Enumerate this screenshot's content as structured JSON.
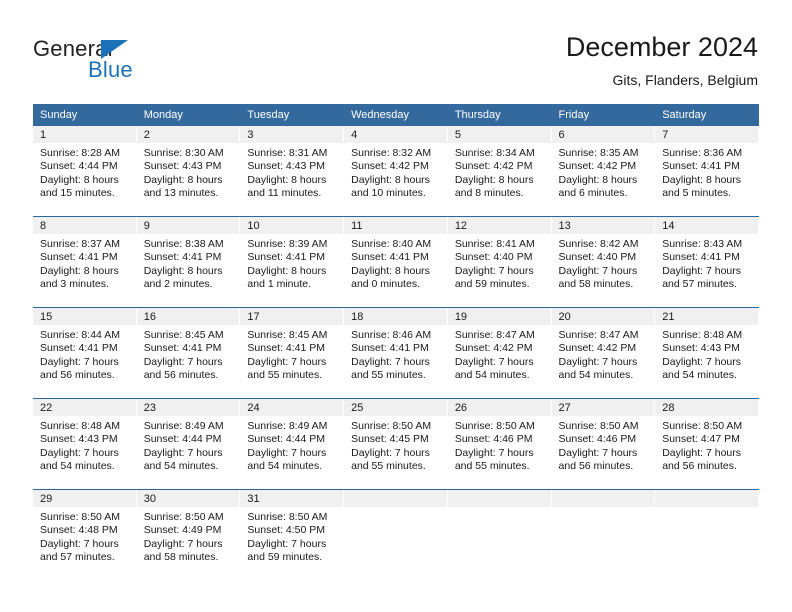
{
  "brand": {
    "logo_line1": "General",
    "logo_line2": "Blue",
    "logo_color_dark": "#231f20",
    "logo_color_blue": "#1c72b8",
    "triangle_icon": "triangle-icon"
  },
  "header": {
    "title": "December 2024",
    "subtitle": "Gits, Flanders, Belgium"
  },
  "theme": {
    "header_bg": "#34699e",
    "header_text": "#ffffff",
    "daynum_bg": "#f0f0f0",
    "row_divider": "#2a679f",
    "body_text": "#1a1a1a"
  },
  "calendar": {
    "weekdays": [
      "Sunday",
      "Monday",
      "Tuesday",
      "Wednesday",
      "Thursday",
      "Friday",
      "Saturday"
    ],
    "weeks": [
      [
        {
          "day": "1",
          "sunrise": "Sunrise: 8:28 AM",
          "sunset": "Sunset: 4:44 PM",
          "daylight_1": "Daylight: 8 hours",
          "daylight_2": "and 15 minutes."
        },
        {
          "day": "2",
          "sunrise": "Sunrise: 8:30 AM",
          "sunset": "Sunset: 4:43 PM",
          "daylight_1": "Daylight: 8 hours",
          "daylight_2": "and 13 minutes."
        },
        {
          "day": "3",
          "sunrise": "Sunrise: 8:31 AM",
          "sunset": "Sunset: 4:43 PM",
          "daylight_1": "Daylight: 8 hours",
          "daylight_2": "and 11 minutes."
        },
        {
          "day": "4",
          "sunrise": "Sunrise: 8:32 AM",
          "sunset": "Sunset: 4:42 PM",
          "daylight_1": "Daylight: 8 hours",
          "daylight_2": "and 10 minutes."
        },
        {
          "day": "5",
          "sunrise": "Sunrise: 8:34 AM",
          "sunset": "Sunset: 4:42 PM",
          "daylight_1": "Daylight: 8 hours",
          "daylight_2": "and 8 minutes."
        },
        {
          "day": "6",
          "sunrise": "Sunrise: 8:35 AM",
          "sunset": "Sunset: 4:42 PM",
          "daylight_1": "Daylight: 8 hours",
          "daylight_2": "and 6 minutes."
        },
        {
          "day": "7",
          "sunrise": "Sunrise: 8:36 AM",
          "sunset": "Sunset: 4:41 PM",
          "daylight_1": "Daylight: 8 hours",
          "daylight_2": "and 5 minutes."
        }
      ],
      [
        {
          "day": "8",
          "sunrise": "Sunrise: 8:37 AM",
          "sunset": "Sunset: 4:41 PM",
          "daylight_1": "Daylight: 8 hours",
          "daylight_2": "and 3 minutes."
        },
        {
          "day": "9",
          "sunrise": "Sunrise: 8:38 AM",
          "sunset": "Sunset: 4:41 PM",
          "daylight_1": "Daylight: 8 hours",
          "daylight_2": "and 2 minutes."
        },
        {
          "day": "10",
          "sunrise": "Sunrise: 8:39 AM",
          "sunset": "Sunset: 4:41 PM",
          "daylight_1": "Daylight: 8 hours",
          "daylight_2": "and 1 minute."
        },
        {
          "day": "11",
          "sunrise": "Sunrise: 8:40 AM",
          "sunset": "Sunset: 4:41 PM",
          "daylight_1": "Daylight: 8 hours",
          "daylight_2": "and 0 minutes."
        },
        {
          "day": "12",
          "sunrise": "Sunrise: 8:41 AM",
          "sunset": "Sunset: 4:40 PM",
          "daylight_1": "Daylight: 7 hours",
          "daylight_2": "and 59 minutes."
        },
        {
          "day": "13",
          "sunrise": "Sunrise: 8:42 AM",
          "sunset": "Sunset: 4:40 PM",
          "daylight_1": "Daylight: 7 hours",
          "daylight_2": "and 58 minutes."
        },
        {
          "day": "14",
          "sunrise": "Sunrise: 8:43 AM",
          "sunset": "Sunset: 4:41 PM",
          "daylight_1": "Daylight: 7 hours",
          "daylight_2": "and 57 minutes."
        }
      ],
      [
        {
          "day": "15",
          "sunrise": "Sunrise: 8:44 AM",
          "sunset": "Sunset: 4:41 PM",
          "daylight_1": "Daylight: 7 hours",
          "daylight_2": "and 56 minutes."
        },
        {
          "day": "16",
          "sunrise": "Sunrise: 8:45 AM",
          "sunset": "Sunset: 4:41 PM",
          "daylight_1": "Daylight: 7 hours",
          "daylight_2": "and 56 minutes."
        },
        {
          "day": "17",
          "sunrise": "Sunrise: 8:45 AM",
          "sunset": "Sunset: 4:41 PM",
          "daylight_1": "Daylight: 7 hours",
          "daylight_2": "and 55 minutes."
        },
        {
          "day": "18",
          "sunrise": "Sunrise: 8:46 AM",
          "sunset": "Sunset: 4:41 PM",
          "daylight_1": "Daylight: 7 hours",
          "daylight_2": "and 55 minutes."
        },
        {
          "day": "19",
          "sunrise": "Sunrise: 8:47 AM",
          "sunset": "Sunset: 4:42 PM",
          "daylight_1": "Daylight: 7 hours",
          "daylight_2": "and 54 minutes."
        },
        {
          "day": "20",
          "sunrise": "Sunrise: 8:47 AM",
          "sunset": "Sunset: 4:42 PM",
          "daylight_1": "Daylight: 7 hours",
          "daylight_2": "and 54 minutes."
        },
        {
          "day": "21",
          "sunrise": "Sunrise: 8:48 AM",
          "sunset": "Sunset: 4:43 PM",
          "daylight_1": "Daylight: 7 hours",
          "daylight_2": "and 54 minutes."
        }
      ],
      [
        {
          "day": "22",
          "sunrise": "Sunrise: 8:48 AM",
          "sunset": "Sunset: 4:43 PM",
          "daylight_1": "Daylight: 7 hours",
          "daylight_2": "and 54 minutes."
        },
        {
          "day": "23",
          "sunrise": "Sunrise: 8:49 AM",
          "sunset": "Sunset: 4:44 PM",
          "daylight_1": "Daylight: 7 hours",
          "daylight_2": "and 54 minutes."
        },
        {
          "day": "24",
          "sunrise": "Sunrise: 8:49 AM",
          "sunset": "Sunset: 4:44 PM",
          "daylight_1": "Daylight: 7 hours",
          "daylight_2": "and 54 minutes."
        },
        {
          "day": "25",
          "sunrise": "Sunrise: 8:50 AM",
          "sunset": "Sunset: 4:45 PM",
          "daylight_1": "Daylight: 7 hours",
          "daylight_2": "and 55 minutes."
        },
        {
          "day": "26",
          "sunrise": "Sunrise: 8:50 AM",
          "sunset": "Sunset: 4:46 PM",
          "daylight_1": "Daylight: 7 hours",
          "daylight_2": "and 55 minutes."
        },
        {
          "day": "27",
          "sunrise": "Sunrise: 8:50 AM",
          "sunset": "Sunset: 4:46 PM",
          "daylight_1": "Daylight: 7 hours",
          "daylight_2": "and 56 minutes."
        },
        {
          "day": "28",
          "sunrise": "Sunrise: 8:50 AM",
          "sunset": "Sunset: 4:47 PM",
          "daylight_1": "Daylight: 7 hours",
          "daylight_2": "and 56 minutes."
        }
      ],
      [
        {
          "day": "29",
          "sunrise": "Sunrise: 8:50 AM",
          "sunset": "Sunset: 4:48 PM",
          "daylight_1": "Daylight: 7 hours",
          "daylight_2": "and 57 minutes."
        },
        {
          "day": "30",
          "sunrise": "Sunrise: 8:50 AM",
          "sunset": "Sunset: 4:49 PM",
          "daylight_1": "Daylight: 7 hours",
          "daylight_2": "and 58 minutes."
        },
        {
          "day": "31",
          "sunrise": "Sunrise: 8:50 AM",
          "sunset": "Sunset: 4:50 PM",
          "daylight_1": "Daylight: 7 hours",
          "daylight_2": "and 59 minutes."
        },
        {
          "day": "",
          "sunrise": "",
          "sunset": "",
          "daylight_1": "",
          "daylight_2": ""
        },
        {
          "day": "",
          "sunrise": "",
          "sunset": "",
          "daylight_1": "",
          "daylight_2": ""
        },
        {
          "day": "",
          "sunrise": "",
          "sunset": "",
          "daylight_1": "",
          "daylight_2": ""
        },
        {
          "day": "",
          "sunrise": "",
          "sunset": "",
          "daylight_1": "",
          "daylight_2": ""
        }
      ]
    ]
  }
}
